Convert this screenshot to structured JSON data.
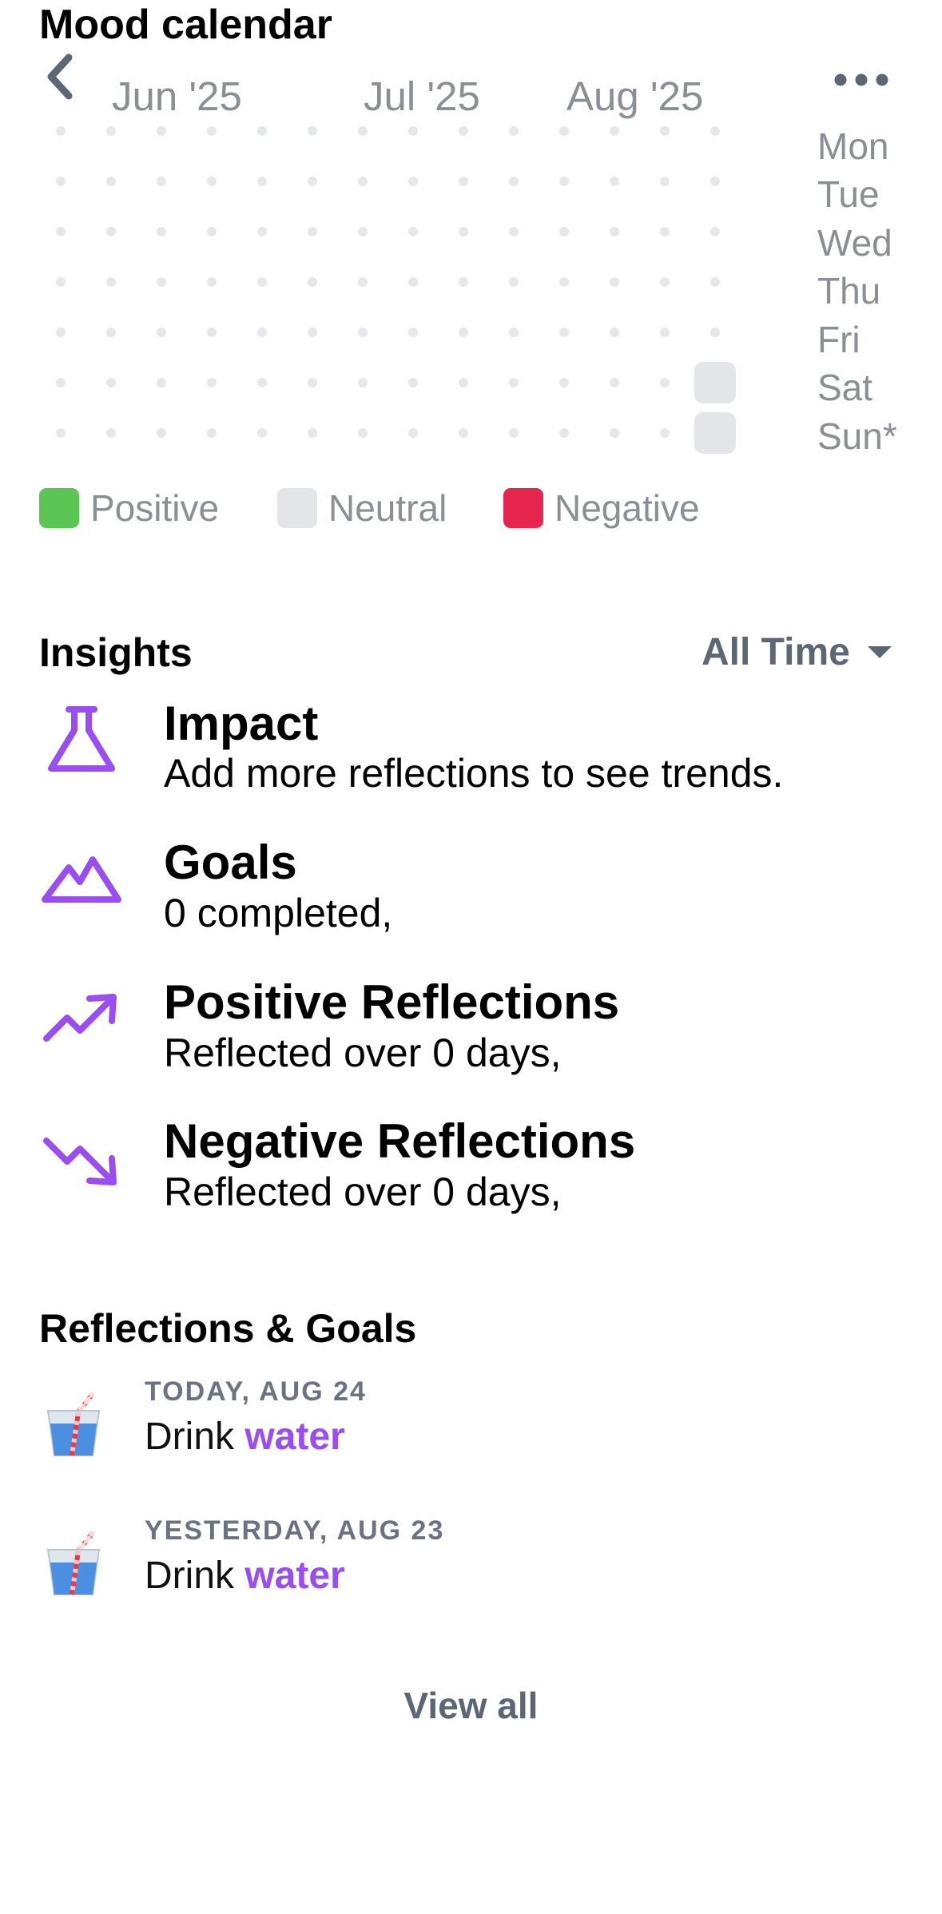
{
  "mood_calendar": {
    "title": "Mood calendar",
    "months": [
      "Jun '25",
      "Jul '25",
      "Aug '25"
    ],
    "days": [
      "Mon",
      "Tue",
      "Wed",
      "Thu",
      "Fri",
      "Sat",
      "Sun*"
    ],
    "legend": [
      {
        "label": "Positive",
        "color": "#5cc654"
      },
      {
        "label": "Neutral",
        "color": "#e4e5e8"
      },
      {
        "label": "Negative",
        "color": "#e6254f"
      }
    ]
  },
  "insights": {
    "heading": "Insights",
    "filter": "All Time",
    "items": [
      {
        "icon": "flask-icon",
        "title": "Impact",
        "subtitle": "Add more reflections to see trends."
      },
      {
        "icon": "mountain-icon",
        "title": "Goals",
        "subtitle": "0 completed,"
      },
      {
        "icon": "trending-up-icon",
        "title": "Positive Reflections",
        "subtitle": "Reflected over 0 days,"
      },
      {
        "icon": "trending-down-icon",
        "title": "Negative Reflections",
        "subtitle": "Reflected over 0 days,"
      }
    ]
  },
  "reflections": {
    "heading": "Reflections & Goals",
    "items": [
      {
        "icon": "cup-with-straw-icon",
        "date": "TODAY, AUG 24",
        "prefix": "Drink ",
        "highlight": "water"
      },
      {
        "icon": "cup-with-straw-icon",
        "date": "YESTERDAY, AUG 23",
        "prefix": "Drink ",
        "highlight": "water"
      }
    ],
    "view_all": "View all"
  },
  "colors": {
    "accent": "#9b4ef0",
    "muted": "#8a8f96"
  }
}
